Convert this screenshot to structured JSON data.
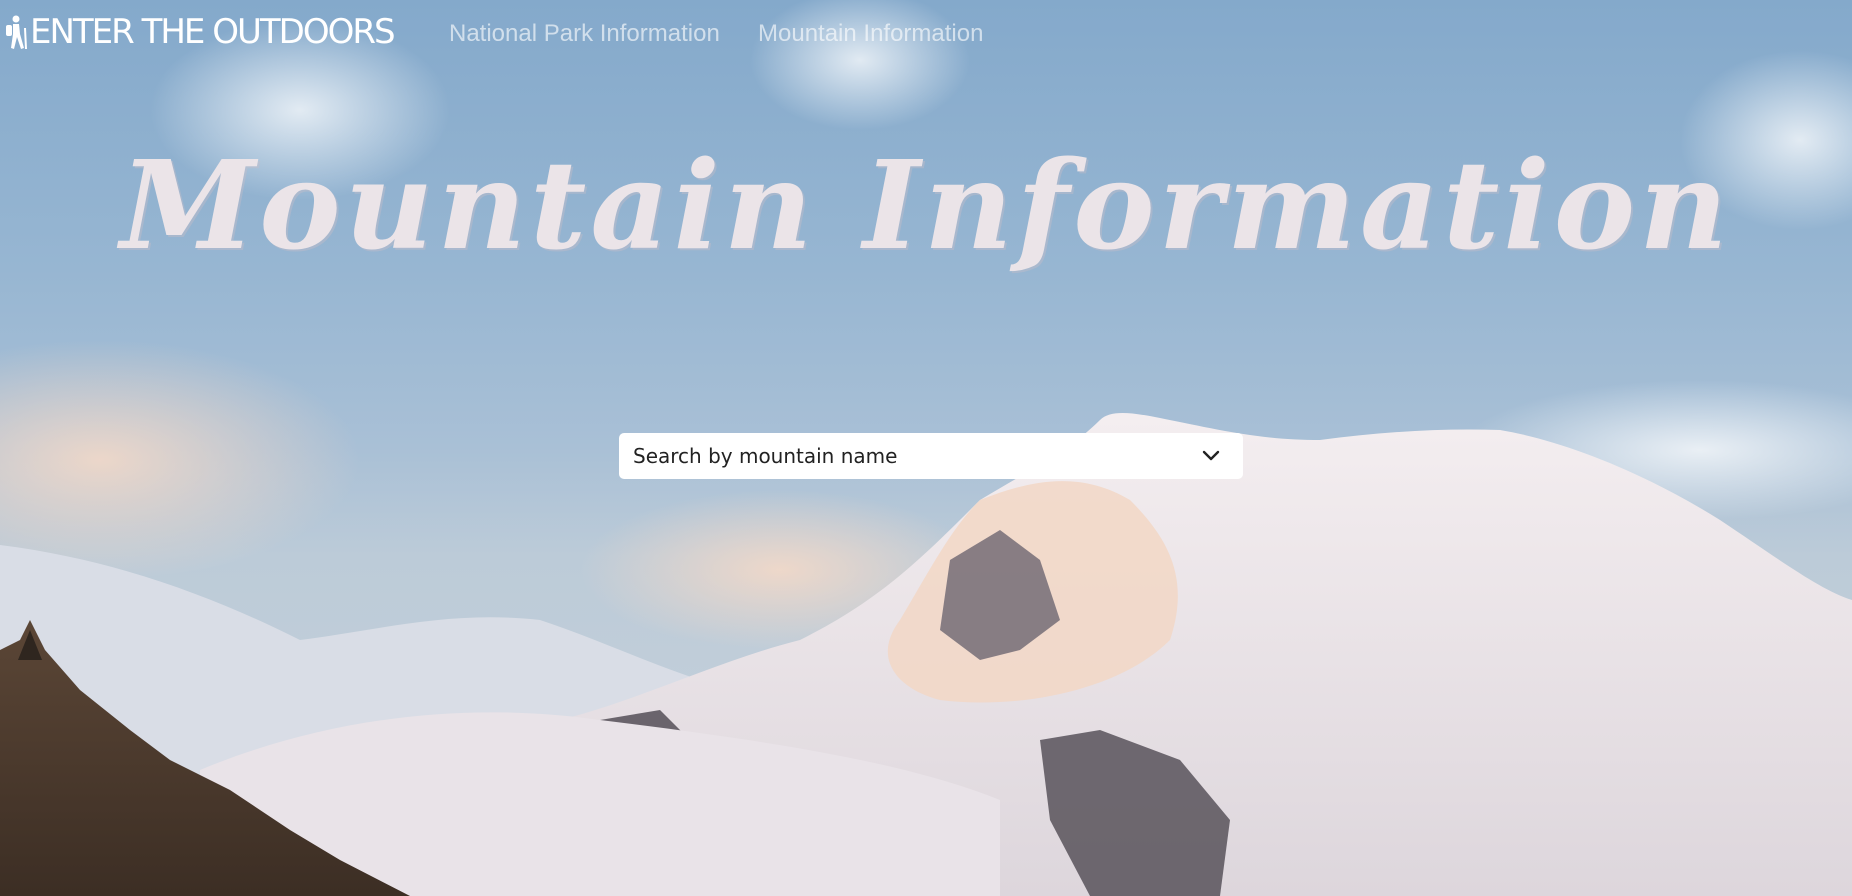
{
  "navbar": {
    "brand": "ENTER THE OUTDOORS",
    "brand_icon": "hiker-icon",
    "links": [
      {
        "label": "National Park Information"
      },
      {
        "label": "Mountain Information"
      }
    ]
  },
  "hero": {
    "title": "Mountain Information",
    "background": "snowy-mountain-photo"
  },
  "search": {
    "placeholder": "Search by mountain name",
    "icon": "chevron-down-icon"
  },
  "colors": {
    "sky": "#97b6d2",
    "title": "#ebe4e8",
    "nav_link": "#d6dfe9",
    "brand": "#ffffff"
  }
}
